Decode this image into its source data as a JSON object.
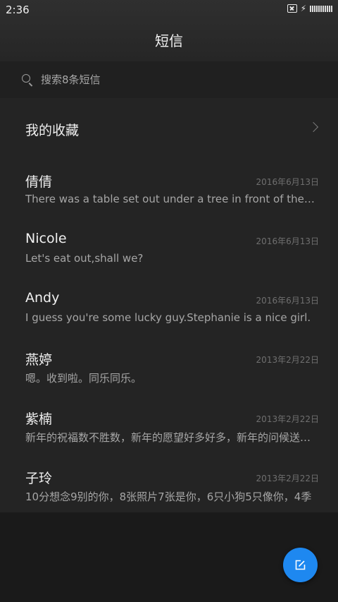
{
  "status_bar": {
    "time": "2:36",
    "icons": [
      "sim-error-icon",
      "charging-bolt-icon",
      "battery-icon"
    ]
  },
  "header": {
    "title": "短信"
  },
  "search": {
    "placeholder": "搜索8条短信"
  },
  "favorites": {
    "label": "我的收藏"
  },
  "conversations": [
    {
      "name": "倩倩",
      "date": "2016年6月13日",
      "preview": "There was a table set out under a tree in front of the house"
    },
    {
      "name": "Nicole",
      "date": "2016年6月13日",
      "preview": "Let's eat out,shall we?"
    },
    {
      "name": "Andy",
      "date": "2016年6月13日",
      "preview": "I guess you're some lucky guy.Stephanie is a nice girl."
    },
    {
      "name": "燕婷",
      "date": "2013年2月22日",
      "preview": "嗯。收到啦。同乐同乐。"
    },
    {
      "name": "紫楠",
      "date": "2013年2月22日",
      "preview": "新年的祝福数不胜数，新年的愿望好多好多，新年的问候送给你"
    },
    {
      "name": "子玲",
      "date": "2013年2月22日",
      "preview": "10分想念9别的你，8张照片7张是你，6只小狗5只像你，4季"
    }
  ],
  "fab": {
    "icon": "compose-icon",
    "color": "#1e88f0"
  }
}
